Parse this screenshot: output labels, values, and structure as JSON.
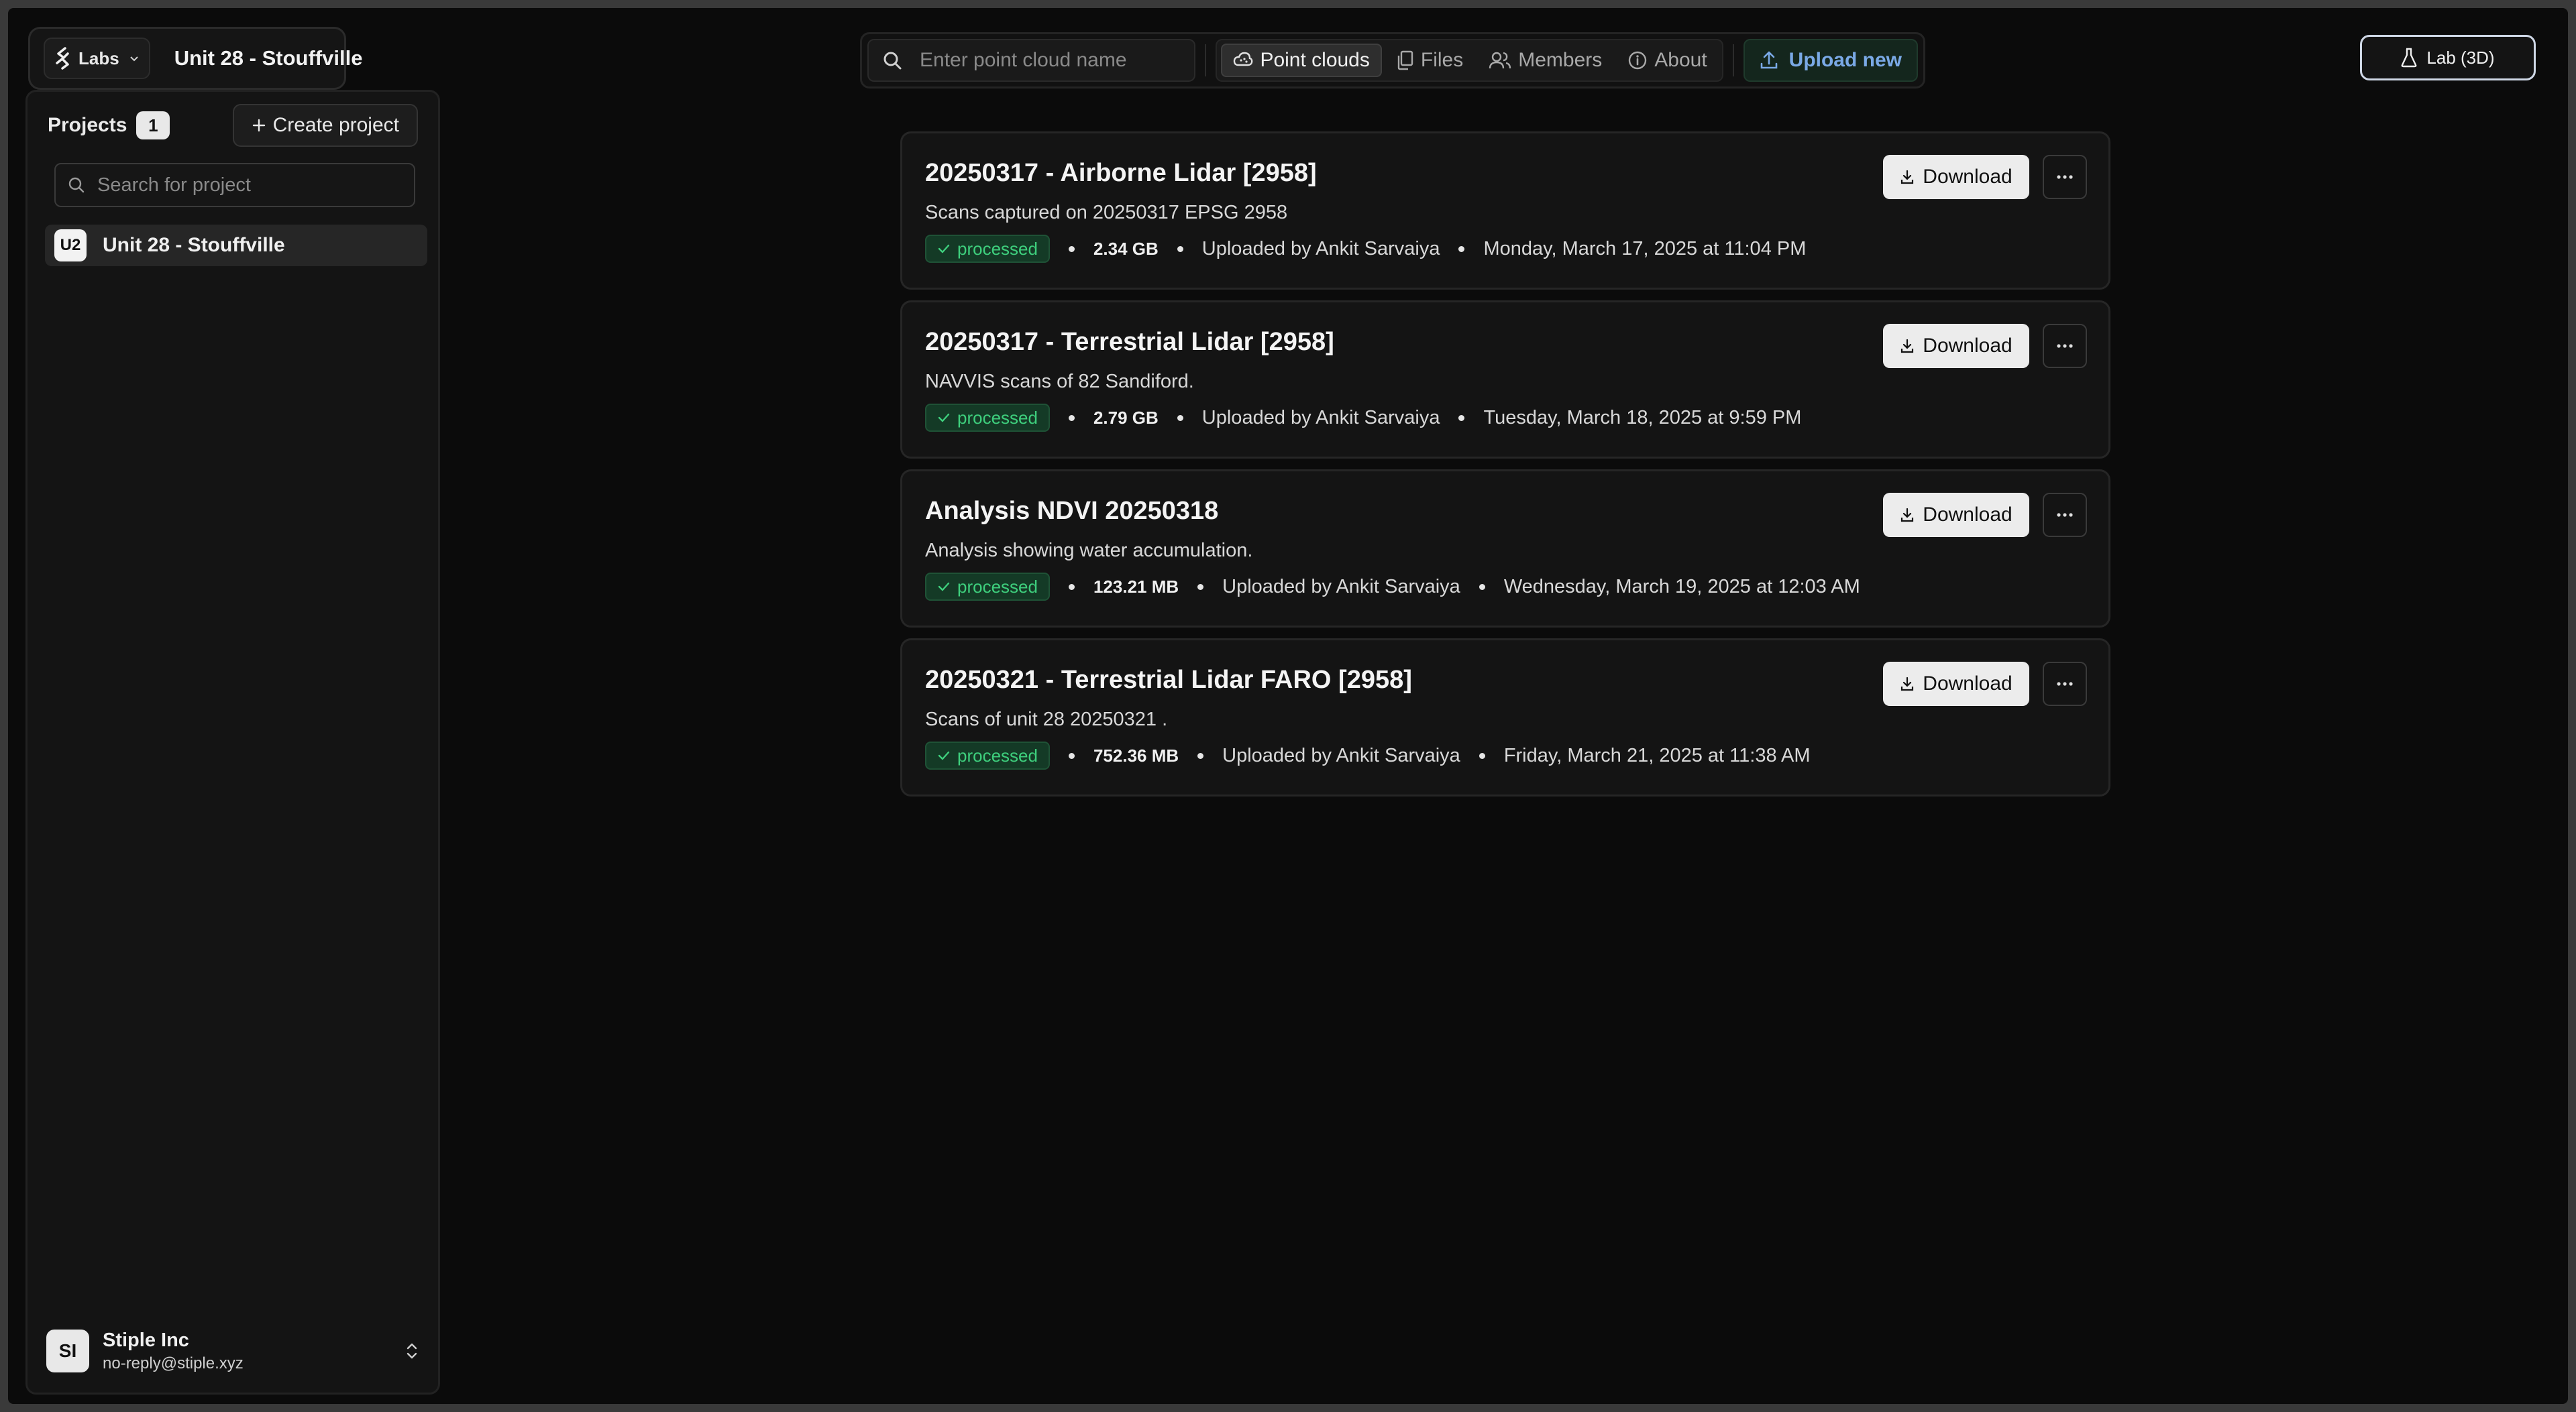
{
  "org": {
    "name": "Labs",
    "project": "Unit 28 - Stouffville"
  },
  "topnav": {
    "search_placeholder": "Enter point cloud name",
    "tabs": [
      {
        "label": "Point clouds",
        "icon": "cloud-icon"
      },
      {
        "label": "Files",
        "icon": "files-icon"
      },
      {
        "label": "Members",
        "icon": "members-icon"
      },
      {
        "label": "About",
        "icon": "info-icon"
      }
    ],
    "upload_label": "Upload new",
    "lab_label": "Lab (3D)"
  },
  "sidebar": {
    "title": "Projects",
    "count": "1",
    "create_label": "Create project",
    "search_placeholder": "Search for project",
    "projects": [
      {
        "initials": "U2",
        "name": "Unit 28 - Stouffville"
      }
    ],
    "user": {
      "initials": "SI",
      "name": "Stiple Inc",
      "email": "no-reply@stiple.xyz"
    }
  },
  "cards": [
    {
      "title": "20250317 - Airborne Lidar [2958]",
      "desc": "Scans captured on 20250317 EPSG 2958",
      "status": "processed",
      "size": "2.34 GB",
      "uploader": "Uploaded by Ankit Sarvaiya",
      "date": "Monday, March 17, 2025 at 11:04 PM",
      "download_label": "Download"
    },
    {
      "title": "20250317 - Terrestrial Lidar [2958]",
      "desc": "NAVVIS scans of 82 Sandiford.",
      "status": "processed",
      "size": "2.79 GB",
      "uploader": "Uploaded by Ankit Sarvaiya",
      "date": "Tuesday, March 18, 2025 at 9:59 PM",
      "download_label": "Download"
    },
    {
      "title": "Analysis NDVI 20250318",
      "desc": "Analysis showing water accumulation.",
      "status": "processed",
      "size": "123.21 MB",
      "uploader": "Uploaded by Ankit Sarvaiya",
      "date": "Wednesday, March 19, 2025 at 12:03 AM",
      "download_label": "Download"
    },
    {
      "title": "20250321 - Terrestrial Lidar FARO [2958]",
      "desc": "Scans of unit 28 20250321 .",
      "status": "processed",
      "size": "752.36 MB",
      "uploader": "Uploaded by Ankit Sarvaiya",
      "date": "Friday, March 21, 2025 at 11:38 AM",
      "download_label": "Download"
    }
  ]
}
